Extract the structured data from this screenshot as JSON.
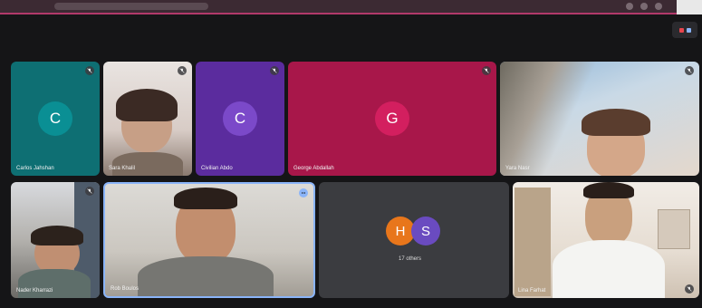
{
  "colors": {
    "teal": "#0e6f73",
    "purple": "#5b2c9e",
    "crimson": "#a8174a",
    "others_bg": "#3b3c40",
    "accent_bar": "#b2396a"
  },
  "participants": [
    {
      "name": "Carlos Jahshan",
      "initial": "C",
      "avatar_color": "#0a8f94"
    },
    {
      "name": "Sara Khalil",
      "initial": "",
      "avatar_color": ""
    },
    {
      "name": "Civilian Abdo",
      "initial": "C",
      "avatar_color": "#7b49c9"
    },
    {
      "name": "George Abdallah",
      "initial": "G",
      "avatar_color": "#d31f5f"
    },
    {
      "name": "Yara Nasr",
      "initial": "",
      "avatar_color": ""
    },
    {
      "name": "Nader Kharrazi",
      "initial": "",
      "avatar_color": ""
    },
    {
      "name": "Rob Boulos",
      "initial": "",
      "avatar_color": ""
    },
    {
      "name": "Lina Farhat",
      "initial": "",
      "avatar_color": ""
    }
  ],
  "others": {
    "avatars": [
      {
        "initial": "H",
        "color": "#e8761b"
      },
      {
        "initial": "S",
        "color": "#6a4bc0"
      }
    ],
    "label": "17 others"
  },
  "icons": {
    "mic": "mic-off-icon",
    "layout": "grid-layout-icon",
    "more": "more-options-icon"
  }
}
